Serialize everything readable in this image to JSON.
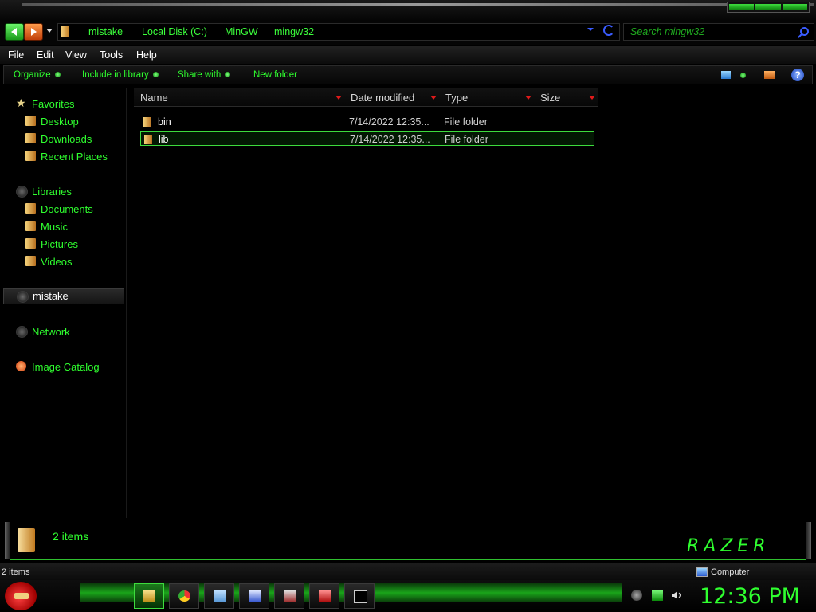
{
  "breadcrumb": [
    "mistake",
    "Local Disk (C:)",
    "MinGW",
    "mingw32"
  ],
  "search": {
    "placeholder": "Search mingw32"
  },
  "menu": [
    "File",
    "Edit",
    "View",
    "Tools",
    "Help"
  ],
  "commands": [
    "Organize",
    "Include in library",
    "Share with",
    "New folder"
  ],
  "help_glyph": "?",
  "sidebar": {
    "favorites": {
      "label": "Favorites",
      "items": [
        "Desktop",
        "Downloads",
        "Recent Places"
      ]
    },
    "libraries": {
      "label": "Libraries",
      "items": [
        "Documents",
        "Music",
        "Pictures",
        "Videos"
      ]
    },
    "homegroup": "mistake",
    "network": "Network",
    "image_catalog": "Image Catalog"
  },
  "columns": [
    "Name",
    "Date modified",
    "Type",
    "Size"
  ],
  "files": [
    {
      "name": "bin",
      "date": "7/14/2022 12:35...",
      "type": "File folder",
      "selected": false
    },
    {
      "name": "lib",
      "date": "7/14/2022 12:35...",
      "type": "File folder",
      "selected": true
    }
  ],
  "details": {
    "count": "2 items",
    "logo_text": "RAZER"
  },
  "status": {
    "left": "2 items",
    "right": "Computer"
  },
  "clock": "12:36 PM",
  "colors": {
    "accent_green": "#2fff2f",
    "selection_border": "#3ddc3d",
    "sort_dropdown": "#e01a1a"
  },
  "taskbar_icons": [
    "explorer-icon",
    "chrome-icon",
    "notepad-icon",
    "task-icon",
    "media-icon",
    "app-icon",
    "cmd-icon"
  ]
}
